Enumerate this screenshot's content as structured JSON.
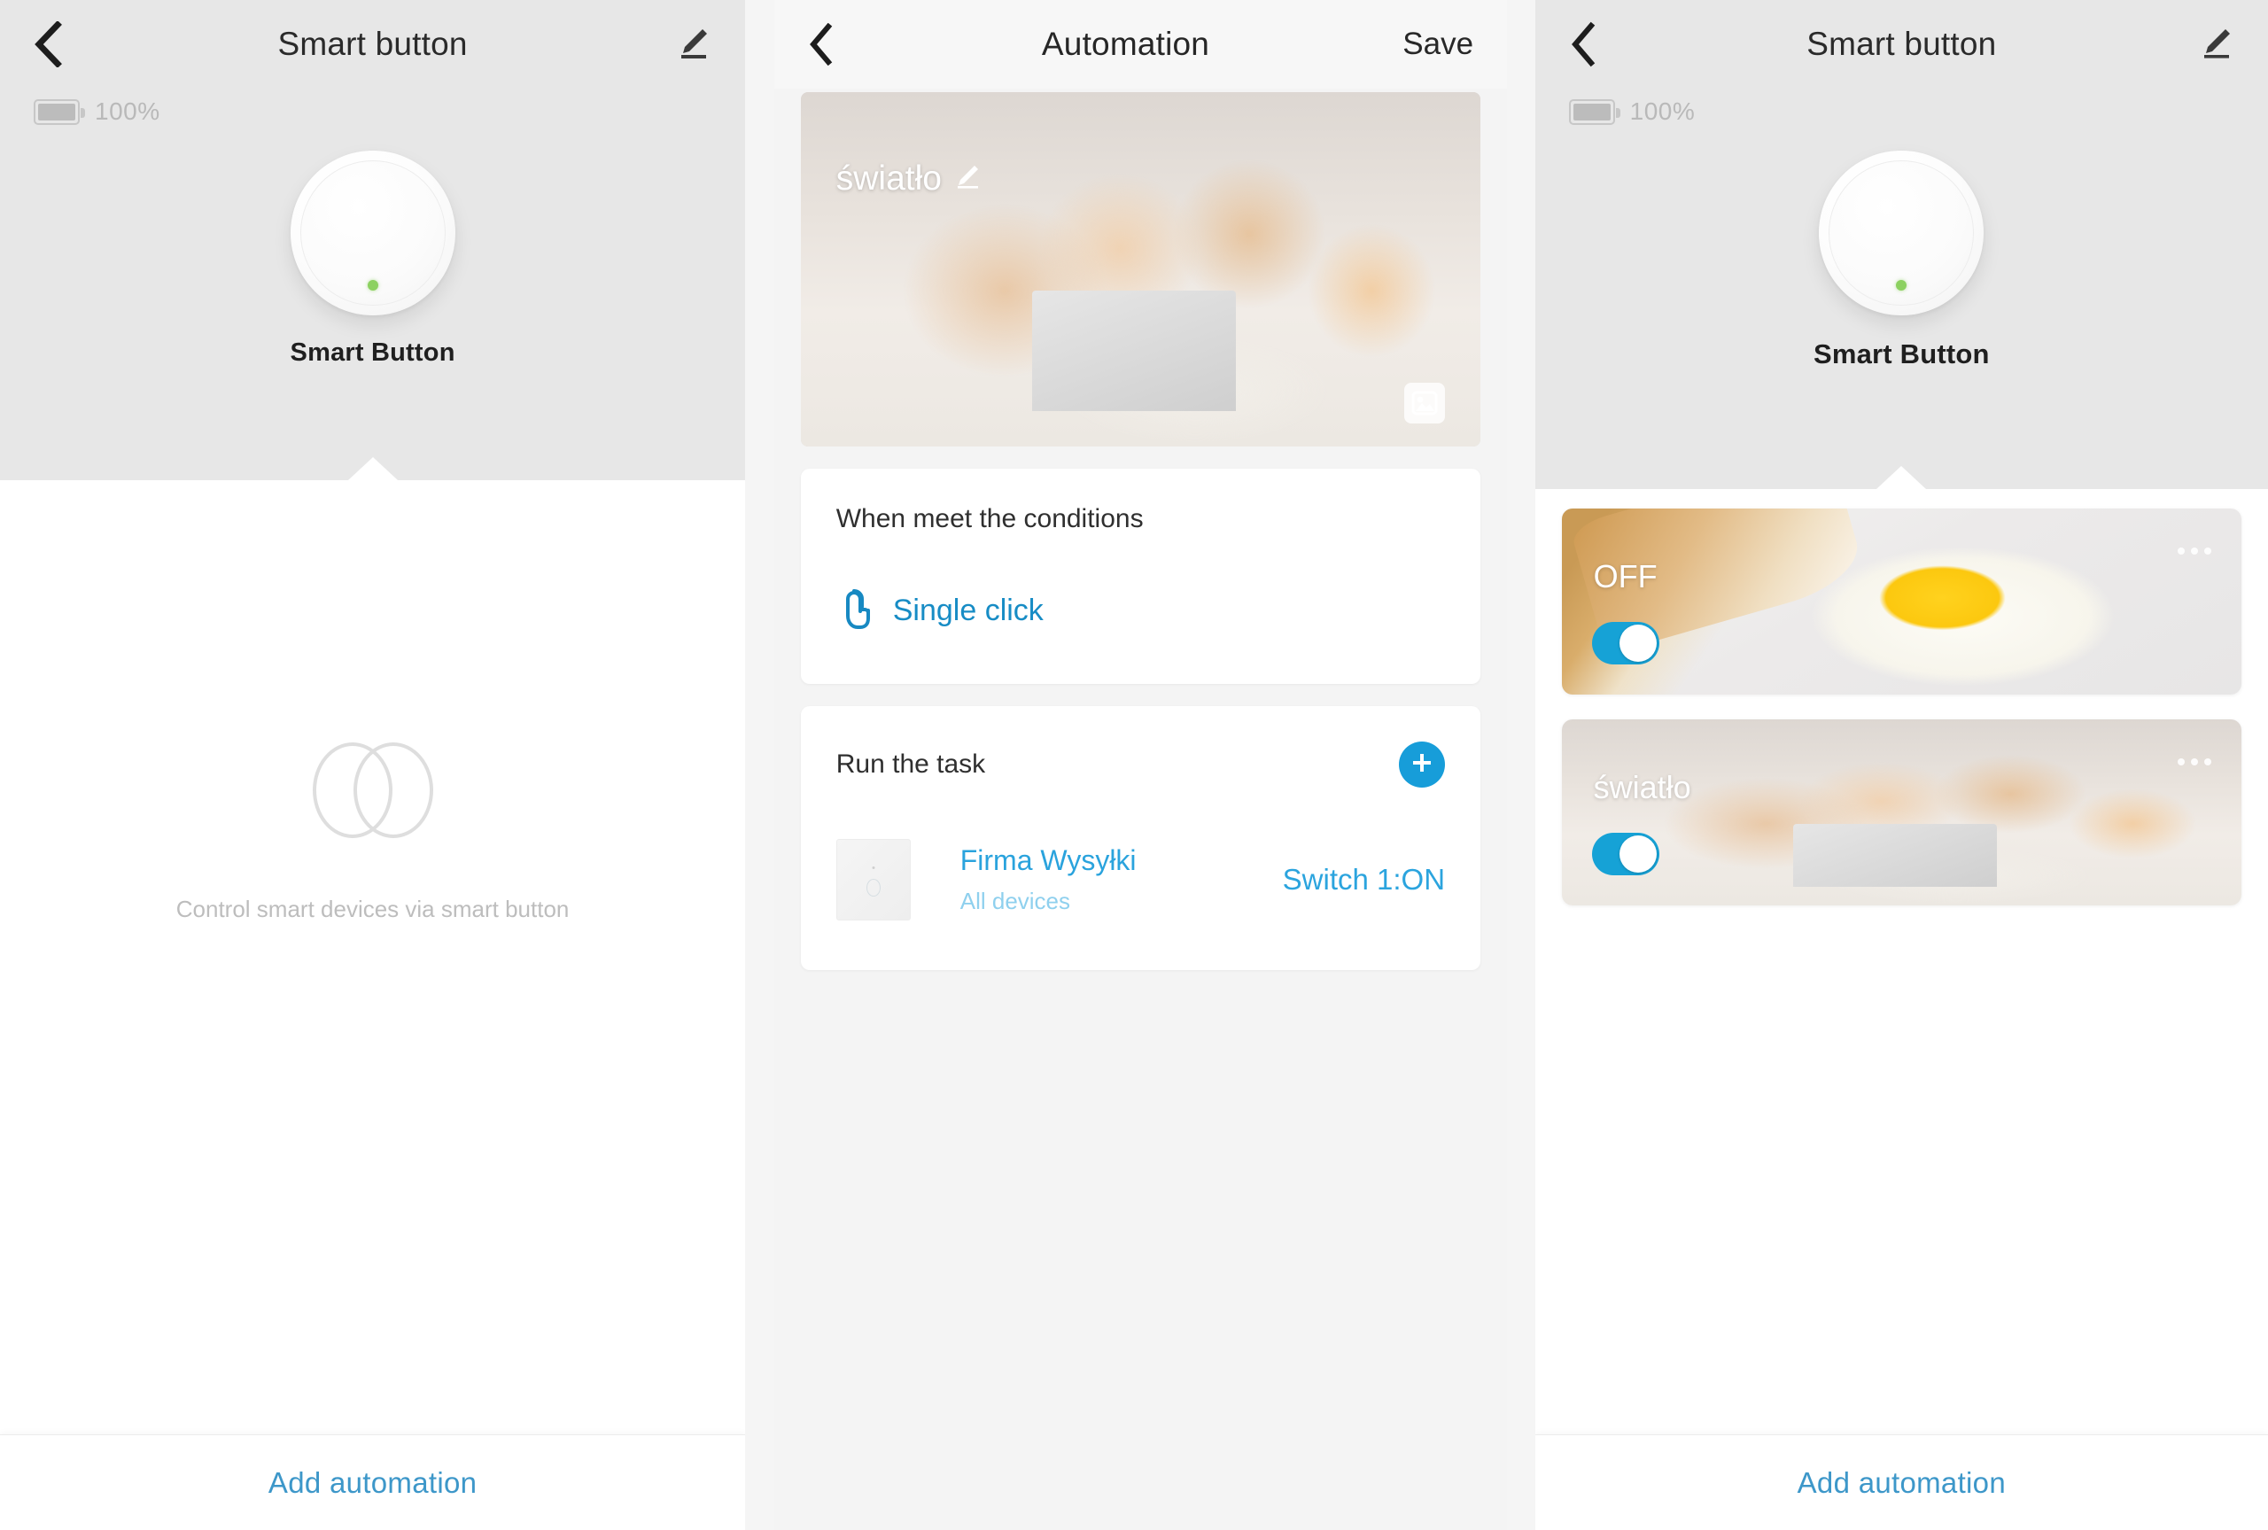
{
  "left_screen": {
    "nav": {
      "back_icon": "chevron-left-icon",
      "title": "Smart button",
      "edit_icon": "pencil-edit-icon"
    },
    "battery": {
      "icon": "battery-icon",
      "level": "100%"
    },
    "device": {
      "name": "Smart Button",
      "led_color": "#8cd160"
    },
    "empty_state": {
      "icon": "two-overlapping-circles-icon",
      "text": "Control smart devices via smart button"
    },
    "bottom": {
      "add_automation": "Add automation"
    }
  },
  "mid_screen": {
    "nav": {
      "back_icon": "chevron-left-icon",
      "title": "Automation",
      "save_label": "Save"
    },
    "hero": {
      "title": "światło",
      "edit_icon": "pencil-edit-icon",
      "image_picker_icon": "image-picker-icon"
    },
    "conditions": {
      "title": "When meet the conditions",
      "item_icon": "tap-finger-icon",
      "item_label": "Single click"
    },
    "tasks": {
      "title": "Run the task",
      "add_icon": "plus-icon",
      "rows": [
        {
          "thumb_icon": "wall-switch-icon",
          "name": "Firma Wysyłki",
          "subtitle": "All devices",
          "state": "Switch 1:ON"
        }
      ]
    }
  },
  "right_screen": {
    "nav": {
      "back_icon": "chevron-left-icon",
      "title": "Smart button",
      "edit_icon": "pencil-edit-icon"
    },
    "battery": {
      "icon": "battery-icon",
      "level": "100%"
    },
    "device": {
      "name": "Smart Button",
      "led_color": "#8cd160"
    },
    "scenes": [
      {
        "label": "OFF",
        "toggle_on": true,
        "menu_icon": "more-dots-icon"
      },
      {
        "label": "światło",
        "toggle_on": true,
        "menu_icon": "more-dots-icon"
      }
    ],
    "bottom": {
      "add_automation": "Add automation"
    }
  },
  "colors": {
    "accent_blue": "#179dd9",
    "link_blue": "#3d97c9",
    "header_gray": "#e7e7e7",
    "led_green": "#8cd160"
  }
}
